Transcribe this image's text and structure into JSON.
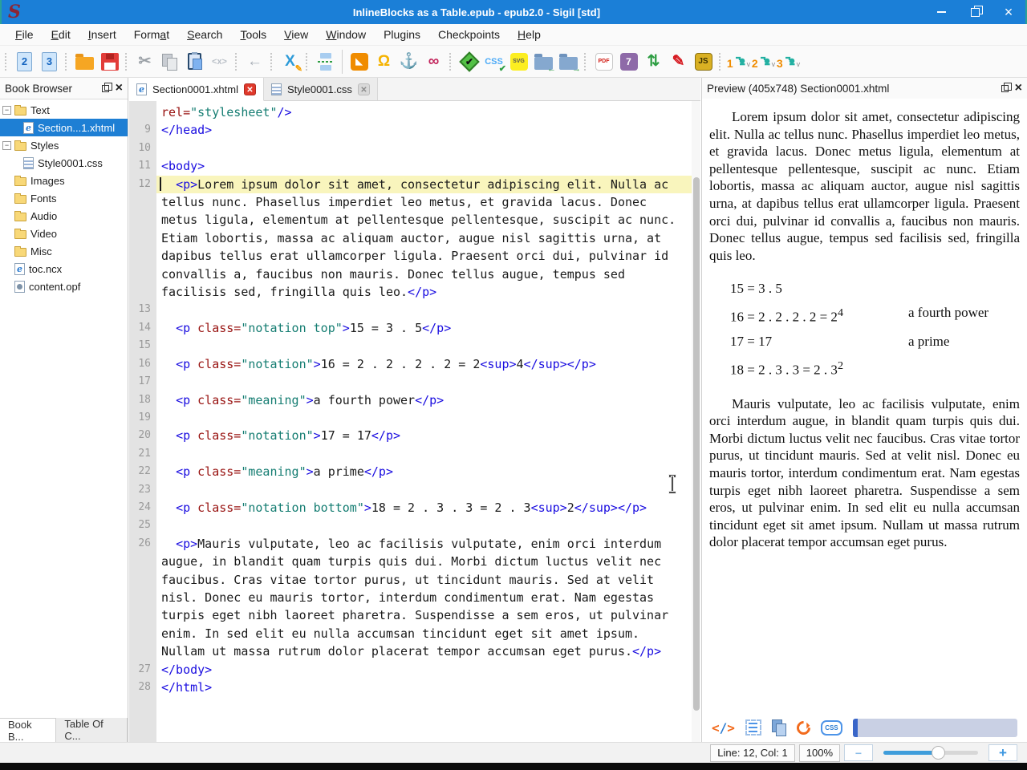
{
  "window": {
    "logo": "S",
    "title": "InlineBlocks as a Table.epub - epub2.0 - Sigil [std]",
    "controls": [
      {
        "name": "minimize"
      },
      {
        "name": "restore"
      },
      {
        "name": "close",
        "glyph": "×"
      }
    ]
  },
  "colors": {
    "titlebar": "#1b7fd7",
    "selection": "#1e7fd4",
    "current_line_highlight": "#f9f5bd",
    "syntax_tag": "#1a0de0",
    "syntax_attribute": "#981210",
    "syntax_string": "#157d72"
  },
  "menu": {
    "items": [
      {
        "label": "File",
        "accel": 0
      },
      {
        "label": "Edit",
        "accel": 0
      },
      {
        "label": "Insert",
        "accel": 0
      },
      {
        "label": "Format",
        "accel": 4
      },
      {
        "label": "Search",
        "accel": 0
      },
      {
        "label": "Tools",
        "accel": 0
      },
      {
        "label": "View",
        "accel": 0
      },
      {
        "label": "Window",
        "accel": 0
      },
      {
        "label": "Plugins",
        "accel": -1
      },
      {
        "label": "Checkpoints",
        "accel": -1
      },
      {
        "label": "Help",
        "accel": 0
      }
    ]
  },
  "toolbar": {
    "items": [
      {
        "k": "sep"
      },
      {
        "k": "btn",
        "name": "new-epub2",
        "shape": "page",
        "glyph": "2",
        "fg": "#1565c0"
      },
      {
        "k": "btn",
        "name": "new-epub3",
        "shape": "page",
        "glyph": "3",
        "fg": "#1565c0"
      },
      {
        "k": "sep"
      },
      {
        "k": "btn",
        "name": "open-file",
        "shape": "folder"
      },
      {
        "k": "btn",
        "name": "save",
        "shape": "floppy"
      },
      {
        "k": "sep"
      },
      {
        "k": "btn",
        "name": "cut",
        "shape": "plain",
        "glyph": "✂",
        "fg": "#9aa0a6",
        "big": true
      },
      {
        "k": "btn",
        "name": "copy",
        "shape": "copy"
      },
      {
        "k": "btn",
        "name": "paste",
        "shape": "paste"
      },
      {
        "k": "btn",
        "name": "code-tags",
        "shape": "plain",
        "glyph": "<x>",
        "fg": "#b9bfc7",
        "fs": "11px"
      },
      {
        "k": "sep"
      },
      {
        "k": "btn",
        "name": "undo",
        "shape": "plain",
        "glyph": "←",
        "fg": "#a7adb5",
        "big": true
      },
      {
        "k": "sep"
      },
      {
        "k": "btn",
        "name": "find-replace",
        "shape": "plain",
        "glyph": "X",
        "fg": "#2d9bd8",
        "big": true,
        "glyph2": "✎",
        "fg2": "#f59f00"
      },
      {
        "k": "sep"
      },
      {
        "k": "btn",
        "name": "split-at-cursor",
        "shape": "split"
      },
      {
        "k": "vsep"
      },
      {
        "k": "btn",
        "name": "insert-image",
        "shape": "chip",
        "bg": "#f08c00",
        "glyph": "◣",
        "fg": "#ffffff",
        "fs": "11px"
      },
      {
        "k": "btn",
        "name": "special-characters",
        "shape": "plain",
        "glyph": "Ω",
        "fg": "#f5b301",
        "big": true
      },
      {
        "k": "btn",
        "name": "insert-anchor",
        "shape": "plain",
        "glyph": "⚓",
        "fg": "#1b8a93",
        "big": true
      },
      {
        "k": "btn",
        "name": "insert-link",
        "shape": "plain",
        "glyph": "∞",
        "fg": "#c2255c",
        "big": true
      },
      {
        "k": "sep"
      },
      {
        "k": "btn",
        "name": "validate-epub",
        "shape": "diamond",
        "glyph": "✔"
      },
      {
        "k": "btn",
        "name": "validate-css",
        "shape": "plain",
        "glyph": "CSS",
        "fg": "#4dabf7",
        "fs": "11px",
        "glyph2": "✔",
        "fg2": "#2f9e44"
      },
      {
        "k": "btn",
        "name": "svg-check",
        "shape": "chip",
        "bg": "#fcee21",
        "glyph": "SVG",
        "fg": "#555",
        "fs": "7px"
      },
      {
        "k": "btn",
        "name": "import-folder",
        "shape": "folder-blue",
        "glyph2": "←",
        "fg2": "#2f9e44"
      },
      {
        "k": "btn",
        "name": "export-folder",
        "shape": "folder-blue",
        "glyph2": "→",
        "fg2": "#2f9e44"
      },
      {
        "k": "sep"
      },
      {
        "k": "btn",
        "name": "pdf-plugin",
        "shape": "chip",
        "bg": "#ffffff",
        "glyph": "PDF",
        "fg": "#d11a12",
        "fs": "7px",
        "border": "#c9c9c9"
      },
      {
        "k": "btn",
        "name": "plugin-7zip",
        "shape": "chip",
        "bg": "#8e6aa8",
        "glyph": "7",
        "fg": "#ffffff",
        "fs": "12px"
      },
      {
        "k": "btn",
        "name": "swap-arrows",
        "shape": "plain",
        "glyph": "⇅",
        "fg": "#2f9e44",
        "big": true
      },
      {
        "k": "btn",
        "name": "red-pencil",
        "shape": "plain",
        "glyph": "✎",
        "fg": "#d6181f",
        "big": true
      },
      {
        "k": "btn",
        "name": "js-plugin",
        "shape": "chip",
        "bg": "#d9b023",
        "glyph": "JS",
        "fg": "#3a2f00",
        "fs": "10px",
        "border": "#8a7010"
      },
      {
        "k": "sep"
      },
      {
        "k": "btn",
        "name": "quick-launch-plugin-1",
        "shape": "robot",
        "digit": "1"
      },
      {
        "k": "btn",
        "name": "quick-launch-plugin-2",
        "shape": "robot",
        "digit": "2"
      },
      {
        "k": "btn",
        "name": "quick-launch-plugin-3",
        "shape": "robot",
        "digit": "3"
      }
    ]
  },
  "book_browser": {
    "title": "Book Browser",
    "items": [
      {
        "label": "Text",
        "icon": "folder",
        "expander": true,
        "indent": 0
      },
      {
        "label": "Section...1.xhtml",
        "icon": "html",
        "indent": 1,
        "selected": true
      },
      {
        "label": "Styles",
        "icon": "folder",
        "expander": true,
        "indent": 0
      },
      {
        "label": "Style0001.css",
        "icon": "css",
        "indent": 1
      },
      {
        "label": "Images",
        "icon": "folder",
        "indent": 0
      },
      {
        "label": "Fonts",
        "icon": "folder",
        "indent": 0
      },
      {
        "label": "Audio",
        "icon": "folder",
        "indent": 0
      },
      {
        "label": "Video",
        "icon": "folder",
        "indent": 0
      },
      {
        "label": "Misc",
        "icon": "folder",
        "indent": 0
      },
      {
        "label": "toc.ncx",
        "icon": "html",
        "indent": 0
      },
      {
        "label": "content.opf",
        "icon": "opf",
        "indent": 0
      }
    ]
  },
  "dock_tabs": [
    {
      "label": "Book B...",
      "active": true
    },
    {
      "label": "Table Of C...",
      "active": false
    }
  ],
  "editor": {
    "tabs": [
      {
        "label": "Section0001.xhtml",
        "icon": "html",
        "active": true,
        "close": "red"
      },
      {
        "label": "Style0001.css",
        "icon": "css",
        "active": false,
        "close": "gray"
      }
    ],
    "lines": [
      {
        "num": "",
        "tokens": [
          {
            "t": "attr",
            "s": "rel="
          },
          {
            "t": "str",
            "s": "\"stylesheet\""
          },
          {
            "t": "tag",
            "s": "/>"
          }
        ]
      },
      {
        "num": "9",
        "tokens": [
          {
            "t": "tag",
            "s": "</head>"
          }
        ]
      },
      {
        "num": "10",
        "tokens": []
      },
      {
        "num": "11",
        "tokens": [
          {
            "t": "tag",
            "s": "<body>"
          }
        ]
      },
      {
        "num": "12",
        "current": true,
        "tokens": [
          {
            "t": "text",
            "s": "  "
          },
          {
            "t": "tag",
            "s": "<p>"
          },
          {
            "t": "text",
            "s": "Lorem ipsum dolor sit amet, consectetur adipiscing elit. Nulla ac tellus nunc. Phasellus imperdiet leo metus, et gravida lacus. Donec metus ligula, elementum at pellentesque pellentesque, suscipit ac nunc. Etiam lobortis, massa ac aliquam auctor, augue nisl sagittis urna, at dapibus tellus erat ullamcorper ligula. Praesent orci dui, pulvinar id convallis a, faucibus non mauris. Donec tellus augue, tempus sed facilisis sed, fringilla quis leo."
          },
          {
            "t": "tag",
            "s": "</p>"
          }
        ]
      },
      {
        "num": "13",
        "tokens": []
      },
      {
        "num": "14",
        "tokens": [
          {
            "t": "text",
            "s": "  "
          },
          {
            "t": "tag",
            "s": "<p"
          },
          {
            "t": "attr",
            "s": " class="
          },
          {
            "t": "str",
            "s": "\"notation top\""
          },
          {
            "t": "tag",
            "s": ">"
          },
          {
            "t": "text",
            "s": "15 = 3 . 5"
          },
          {
            "t": "tag",
            "s": "</p>"
          }
        ]
      },
      {
        "num": "15",
        "tokens": []
      },
      {
        "num": "16",
        "tokens": [
          {
            "t": "text",
            "s": "  "
          },
          {
            "t": "tag",
            "s": "<p"
          },
          {
            "t": "attr",
            "s": " class="
          },
          {
            "t": "str",
            "s": "\"notation\""
          },
          {
            "t": "tag",
            "s": ">"
          },
          {
            "t": "text",
            "s": "16 = 2 . 2 . 2 . 2 = 2"
          },
          {
            "t": "tag",
            "s": "<sup>"
          },
          {
            "t": "text",
            "s": "4"
          },
          {
            "t": "tag",
            "s": "</sup></p>"
          }
        ]
      },
      {
        "num": "17",
        "tokens": []
      },
      {
        "num": "18",
        "tokens": [
          {
            "t": "text",
            "s": "  "
          },
          {
            "t": "tag",
            "s": "<p"
          },
          {
            "t": "attr",
            "s": " class="
          },
          {
            "t": "str",
            "s": "\"meaning\""
          },
          {
            "t": "tag",
            "s": ">"
          },
          {
            "t": "text",
            "s": "a fourth power"
          },
          {
            "t": "tag",
            "s": "</p>"
          }
        ]
      },
      {
        "num": "19",
        "tokens": []
      },
      {
        "num": "20",
        "tokens": [
          {
            "t": "text",
            "s": "  "
          },
          {
            "t": "tag",
            "s": "<p"
          },
          {
            "t": "attr",
            "s": " class="
          },
          {
            "t": "str",
            "s": "\"notation\""
          },
          {
            "t": "tag",
            "s": ">"
          },
          {
            "t": "text",
            "s": "17 = 17"
          },
          {
            "t": "tag",
            "s": "</p>"
          }
        ]
      },
      {
        "num": "21",
        "tokens": []
      },
      {
        "num": "22",
        "tokens": [
          {
            "t": "text",
            "s": "  "
          },
          {
            "t": "tag",
            "s": "<p"
          },
          {
            "t": "attr",
            "s": " class="
          },
          {
            "t": "str",
            "s": "\"meaning\""
          },
          {
            "t": "tag",
            "s": ">"
          },
          {
            "t": "text",
            "s": "a prime"
          },
          {
            "t": "tag",
            "s": "</p>"
          }
        ]
      },
      {
        "num": "23",
        "tokens": []
      },
      {
        "num": "24",
        "tokens": [
          {
            "t": "text",
            "s": "  "
          },
          {
            "t": "tag",
            "s": "<p"
          },
          {
            "t": "attr",
            "s": " class="
          },
          {
            "t": "str",
            "s": "\"notation bottom\""
          },
          {
            "t": "tag",
            "s": ">"
          },
          {
            "t": "text",
            "s": "18 = 2 . 3 . 3 = 2 . 3"
          },
          {
            "t": "tag",
            "s": "<sup>"
          },
          {
            "t": "text",
            "s": "2"
          },
          {
            "t": "tag",
            "s": "</sup></p>"
          }
        ]
      },
      {
        "num": "25",
        "tokens": []
      },
      {
        "num": "26",
        "tokens": [
          {
            "t": "text",
            "s": "  "
          },
          {
            "t": "tag",
            "s": "<p>"
          },
          {
            "t": "text",
            "s": "Mauris vulputate, leo ac facilisis vulputate, enim orci interdum augue, in blandit quam turpis quis dui. Morbi dictum luctus velit nec faucibus. Cras vitae tortor purus, ut tincidunt mauris. Sed at velit nisl. Donec eu mauris tortor, interdum condimentum erat. Nam egestas turpis eget nibh laoreet pharetra. Suspendisse a sem eros, ut pulvinar enim. In sed elit eu nulla accumsan tincidunt eget sit amet ipsum. Nullam ut massa rutrum dolor placerat tempor accumsan eget purus."
          },
          {
            "t": "tag",
            "s": "</p>"
          }
        ]
      },
      {
        "num": "27",
        "tokens": [
          {
            "t": "tag",
            "s": "</body>"
          }
        ]
      },
      {
        "num": "28",
        "tokens": [
          {
            "t": "tag",
            "s": "</html>"
          }
        ]
      }
    ]
  },
  "preview": {
    "title": "Preview (405x748) Section0001.xhtml",
    "paragraph1": "Lorem ipsum dolor sit amet, consectetur adipiscing elit. Nulla ac tellus nunc. Phasellus imperdiet leo metus, et gravida lacus. Donec metus ligula, elementum at pellentesque pellentesque, suscipit ac nunc. Etiam lobortis, massa ac aliquam auctor, augue nisl sagittis urna, at dapibus tellus erat ullamcorper ligula. Praesent orci dui, pulvinar id convallis a, faucibus non mauris. Donec tellus augue, tempus sed facilisis sed, fringilla quis leo.",
    "notation_rows": [
      {
        "text": "15 = 3 . 5",
        "sup": "",
        "meaning": ""
      },
      {
        "text": "16 = 2 . 2 . 2 . 2 = 2",
        "sup": "4",
        "meaning": "a fourth power"
      },
      {
        "text": "17 = 17",
        "sup": "",
        "meaning": "a prime"
      },
      {
        "text": "18 = 2 . 3 . 3 = 2 . 3",
        "sup": "2",
        "meaning": ""
      }
    ],
    "paragraph2": "Mauris vulputate, leo ac facilisis vulputate, enim orci interdum augue, in blandit quam turpis quis dui. Morbi dictum luctus velit nec faucibus. Cras vitae tortor purus, ut tincidunt mauris. Sed at velit nisl. Donec eu mauris tortor, interdum condimentum erat. Nam egestas turpis eget nibh laoreet pharetra. Suspendisse a sem eros, ut pulvinar enim. In sed elit eu nulla accumsan tincidunt eget sit amet ipsum. Nullam ut massa rutrum dolor placerat tempor accumsan eget purus.",
    "toolbar_icons": [
      "code-view",
      "select-all",
      "copy",
      "refresh",
      "refresh-css"
    ],
    "css_badge": "CSS",
    "code_badge": "</>"
  },
  "status": {
    "line_col": "Line: 12, Col: 1",
    "zoom": "100%",
    "minus_label": "−",
    "plus_label": "+",
    "slider_percent": 58
  }
}
